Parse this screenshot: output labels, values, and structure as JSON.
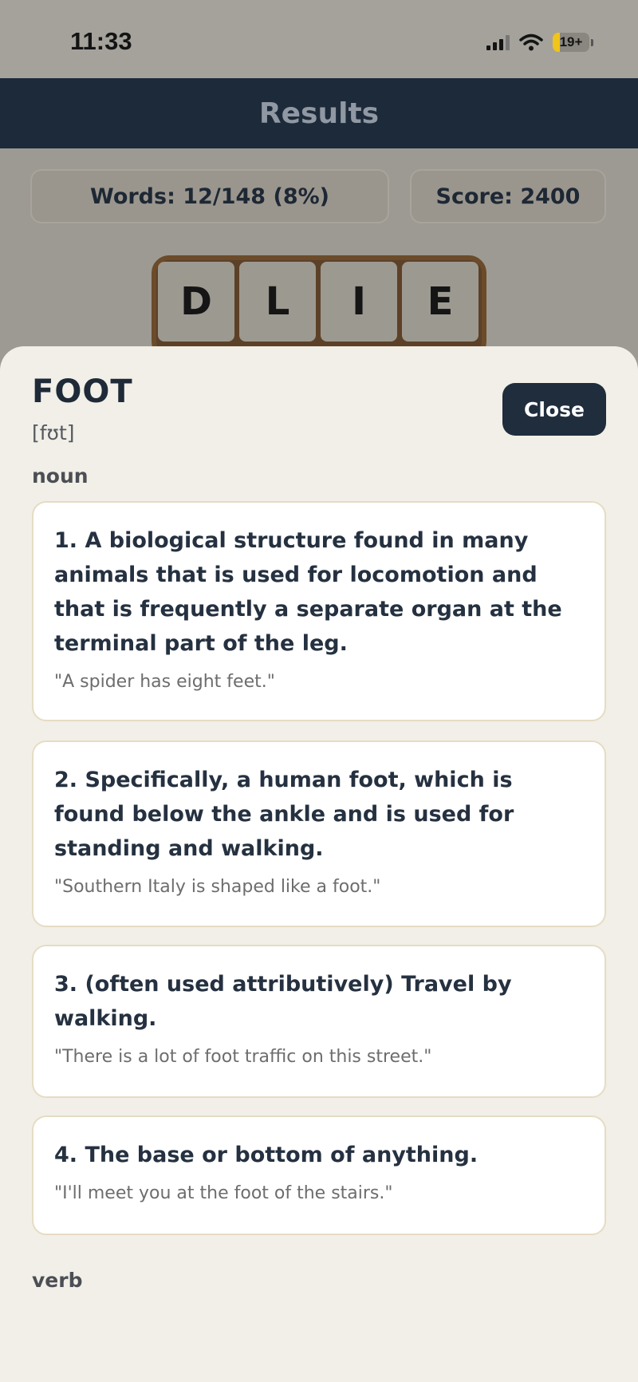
{
  "status_bar": {
    "time": "11:33",
    "battery": "19+"
  },
  "header": {
    "title": "Results"
  },
  "stats": {
    "words": "Words: 12/148 (8%)",
    "score": "Score: 2400"
  },
  "tiles": [
    "D",
    "L",
    "I",
    "E"
  ],
  "definition": {
    "word": "FOOT",
    "phonetic": "[fʊt]",
    "close_label": "Close",
    "noun_label": "noun",
    "verb_label": "verb",
    "senses": [
      {
        "text": "1. A biological structure found in many animals that is used for locomotion and that is frequently a separate organ at the terminal part of the leg.",
        "example": "\"A spider has eight feet.\""
      },
      {
        "text": "2. Specifically, a human foot, which is found below the ankle and is used for standing and walking.",
        "example": "\"Southern Italy is shaped like a foot.\""
      },
      {
        "text": "3. (often used attributively) Travel by walking.",
        "example": "\"There is a lot of foot traffic on this street.\""
      },
      {
        "text": "4. The base or bottom of anything.",
        "example": "\"I'll meet you at the foot of the stairs.\""
      }
    ]
  }
}
